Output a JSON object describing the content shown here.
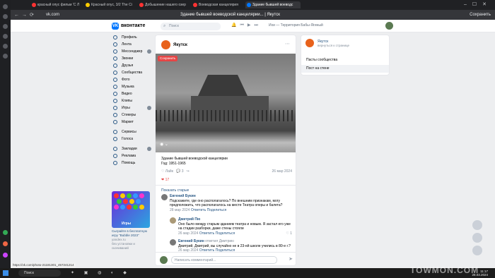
{
  "browser": {
    "tabs": [
      {
        "label": "красный опус фильм 'С Л"
      },
      {
        "label": "Красный опус, 3/2 The Ci"
      },
      {
        "label": "Добышение нашего озер"
      },
      {
        "label": "Воеводская канцелярия"
      },
      {
        "label": "Здание бывшей воеводс"
      }
    ],
    "url": "vk.com",
    "page_title": "Здание бывшей воеводской канцелярии... | Якутск",
    "save_label": "Сохранить"
  },
  "vk": {
    "logo_label": "вконтакте",
    "search_placeholder": "Поиск",
    "player_text": "Ихи — Территория Бабы-Ягиный",
    "nav": [
      {
        "label": "Профиль"
      },
      {
        "label": "Лента"
      },
      {
        "label": "Мессенджер",
        "badge": true
      },
      {
        "label": "Звонки"
      },
      {
        "label": "Друзья"
      },
      {
        "label": "Сообщества"
      },
      {
        "label": "Фото"
      },
      {
        "label": "Музыка"
      },
      {
        "label": "Видео"
      },
      {
        "label": "Клипы"
      },
      {
        "label": "Игры",
        "badge": true
      },
      {
        "label": "Стикеры"
      },
      {
        "label": "Маркет"
      }
    ],
    "nav2": [
      {
        "label": "Сервисы"
      },
      {
        "label": "Голоса"
      }
    ],
    "nav3": [
      {
        "label": "Закладки",
        "badge": true
      },
      {
        "label": "Реклама"
      },
      {
        "label": "Помощь"
      }
    ],
    "ad": {
      "image_label": "Игры",
      "title": "Сыграйте в бесплатную игру \"Bubble 2023\"",
      "domain": "yandex.ru",
      "sub": "без установки и скачиваний"
    }
  },
  "post": {
    "author": "Якутск",
    "save_button": "Сохранить",
    "caption_line1": "Здание бывшей воеводской канцелярии",
    "caption_line2": "Год: 1951-1965",
    "like_label": "Лайк",
    "comment_count": "3",
    "date": "26 мар 2024",
    "likes_count": "17",
    "show_prev": "Показать старые",
    "comments": [
      {
        "name": "Евгений Букин",
        "text": "Подскажите, где оно располагалось? По внешним признакам, могу предположить, что располагалось на месте Театра оперы и балета?",
        "meta_date": "28 мар 2024",
        "reply": "Ответить",
        "share": "Поделиться"
      },
      {
        "name": "Дмитрий Пю",
        "text": "Оно было между старым зданием театра и новым. Я застал его уже на стадии разборки, даже стены стояли",
        "meta_date": "26 мар 2024",
        "reply": "Ответить",
        "share": "Поделиться",
        "likes": "1"
      },
      {
        "name": "Евгений Букин",
        "reply_to": "ответил Дмитрию",
        "text": "Дмитрий, Дмитрий, вы случайно не в 23-ей школе учились в 80-е г.?",
        "meta_date": "26 мар 2024",
        "reply": "Ответить",
        "share": "Поделиться"
      }
    ],
    "composer_placeholder": "Написать комментарий..."
  },
  "right_card": {
    "name": "Якутск",
    "sub": "вернуться к странице",
    "row1": "Пасты сообщества",
    "row2": "Пост на стене"
  },
  "taskbar": {
    "search": "Поиск",
    "time": "11:17",
    "date": "28.03.2024"
  },
  "status_url": "https://vk.com/photo-21181301_457241214",
  "watermark": "TOWMON.COM"
}
